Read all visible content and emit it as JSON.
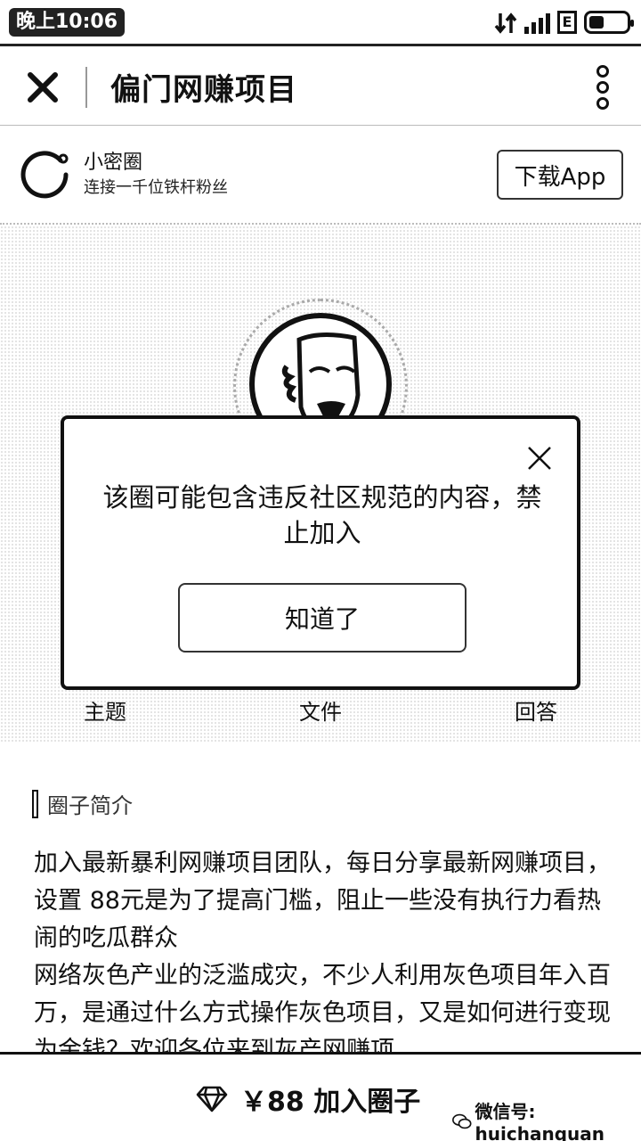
{
  "status_bar": {
    "time": "晚上10:06",
    "net_type": "E",
    "battery_level": 0.4
  },
  "nav": {
    "title": "偏门网赚项目"
  },
  "promo": {
    "app_name": "小密圈",
    "slogan": "连接一千位铁杆粉丝",
    "download_label": "下载App"
  },
  "tabs": [
    "主题",
    "文件",
    "回答"
  ],
  "intro": {
    "heading": "圈子简介",
    "paragraphs": [
      "加入最新暴利网赚项目团队，每日分享最新网赚项目，设置 88元是为了提高门槛，阻止一些没有执行力看热闹的吃瓜群众",
      "网络灰色产业的泛滥成灾，不少人利用灰色项目年入百万，是通过什么方式操作灰色项目，又是如何进行变现为金钱？欢迎各位来到灰产网赚项"
    ]
  },
  "bottom": {
    "join_label": "￥88 加入圈子",
    "watermark": "微信号: huichanquan"
  },
  "modal": {
    "message": "该圈可能包含违反社区规范的内容，禁止加入",
    "confirm_label": "知道了"
  }
}
